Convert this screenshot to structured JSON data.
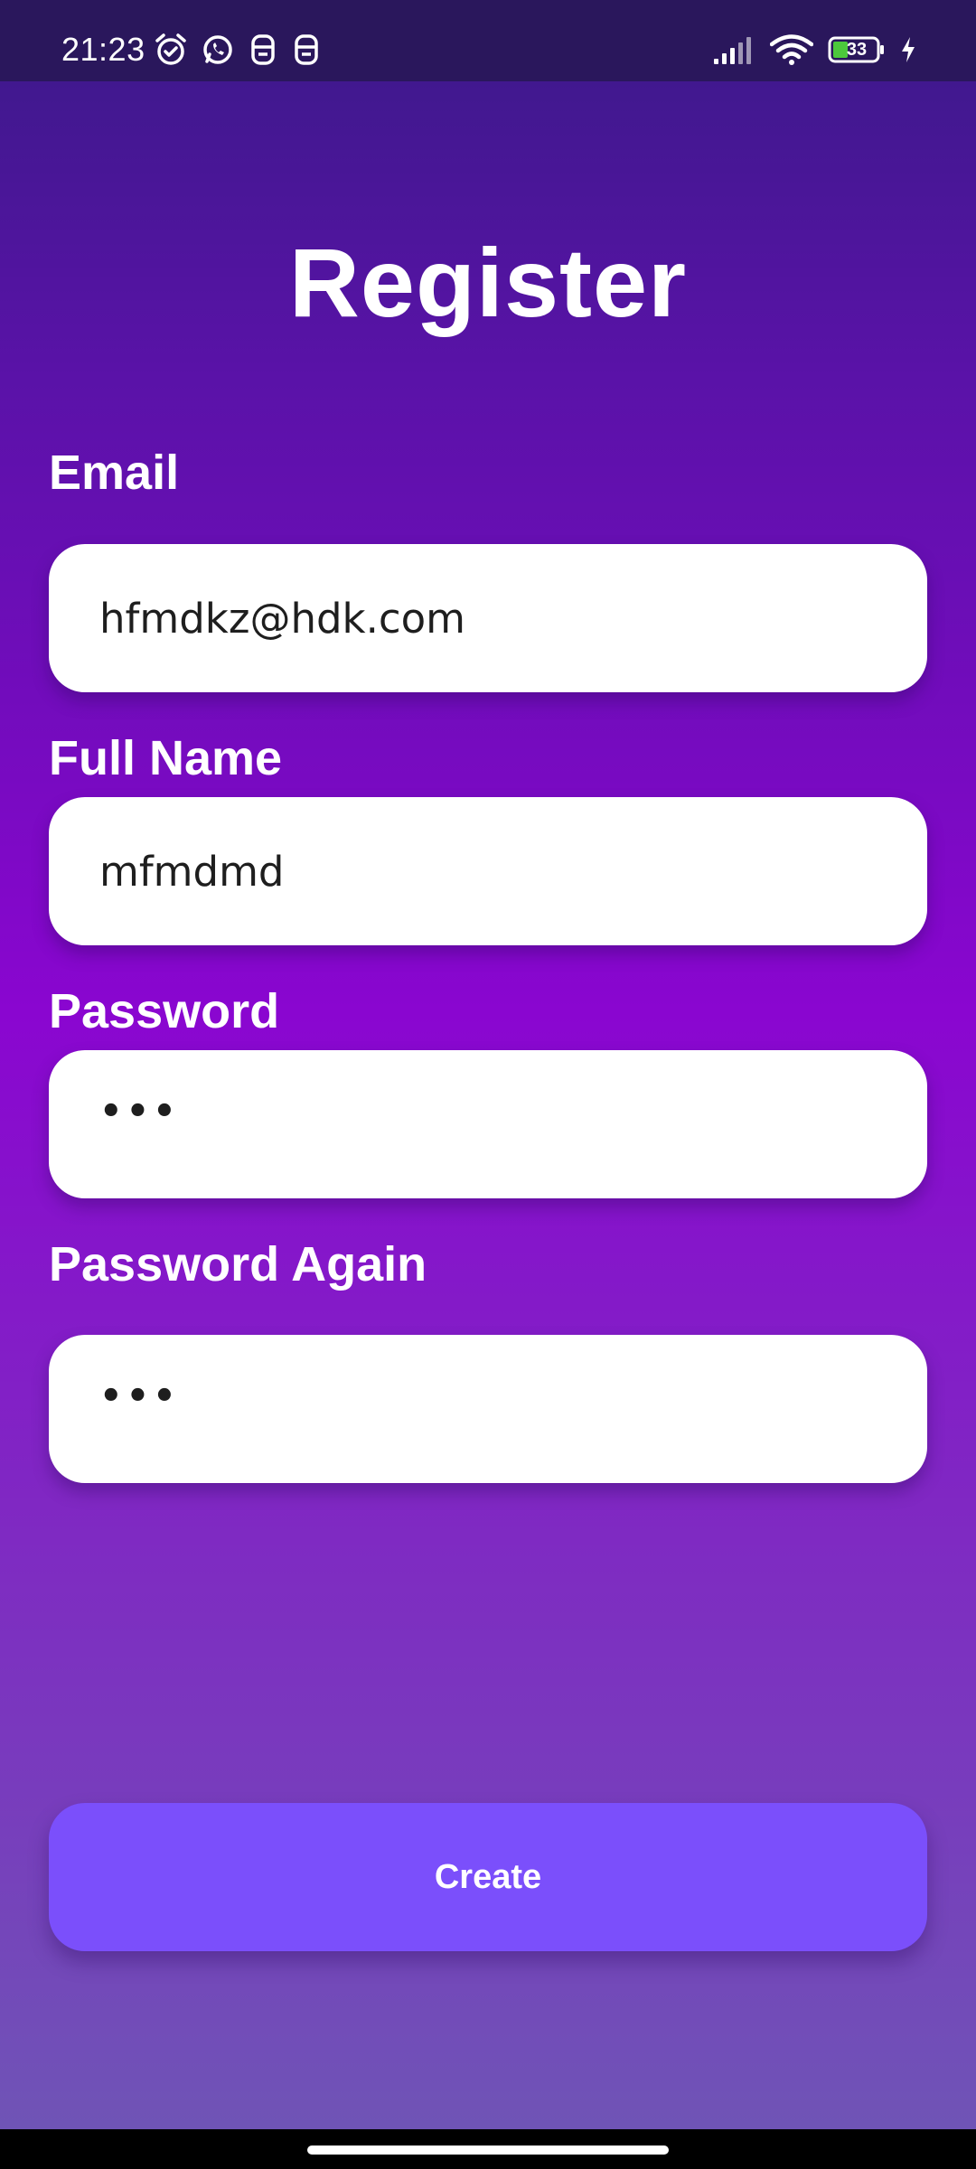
{
  "status_bar": {
    "time": "21:23",
    "battery_level": "33",
    "left_icons": [
      "alarm-icon",
      "whatsapp-icon",
      "app-notification-icon",
      "app-notification-icon"
    ],
    "right_icons": [
      "signal-icon",
      "wifi-icon",
      "battery-icon",
      "charging-icon"
    ]
  },
  "page": {
    "title": "Register"
  },
  "form": {
    "email": {
      "label": "Email",
      "value": "hfmdkz@hdk.com"
    },
    "full_name": {
      "label": "Full Name",
      "value": "mfmdmd"
    },
    "password": {
      "label": "Password",
      "value": "•••"
    },
    "password_again": {
      "label": "Password Again",
      "value": "•••"
    }
  },
  "actions": {
    "create_label": "Create"
  },
  "colors": {
    "status_bar_bg": "#2a175c",
    "gradient_top": "#3a1a88",
    "gradient_mid": "#8a06d0",
    "gradient_bottom": "#6f54b6",
    "button_bg": "#7b4ffb",
    "battery_fill": "#4cc83c"
  }
}
